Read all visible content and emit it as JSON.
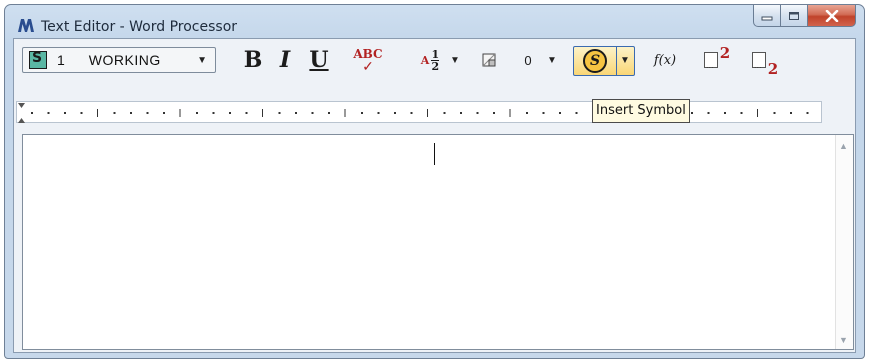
{
  "window": {
    "title": "Text Editor - Word Processor",
    "app_icon": "microstation-icon"
  },
  "caption_buttons": [
    "minimize-icon",
    "maximize-icon",
    "close-icon"
  ],
  "toolbar": {
    "text_style": {
      "number": "1",
      "name": "WORKING"
    },
    "bold_label": "B",
    "italic_label": "I",
    "underline_label": "U",
    "spell_label": "ABC",
    "fraction_label": "A",
    "fraction_num": "1",
    "fraction_den": "2",
    "spacing_value": "0",
    "insert_symbol_label": "S",
    "function_label": "f(x)",
    "superscript_label": "2",
    "subscript_label": "2"
  },
  "tooltip": {
    "text": "Insert Symbol"
  },
  "editor": {
    "content": ""
  },
  "colors": {
    "accent_red": "#b22222",
    "symbol_highlight": "#f9d676",
    "window_frame": "#c7d8eb"
  }
}
